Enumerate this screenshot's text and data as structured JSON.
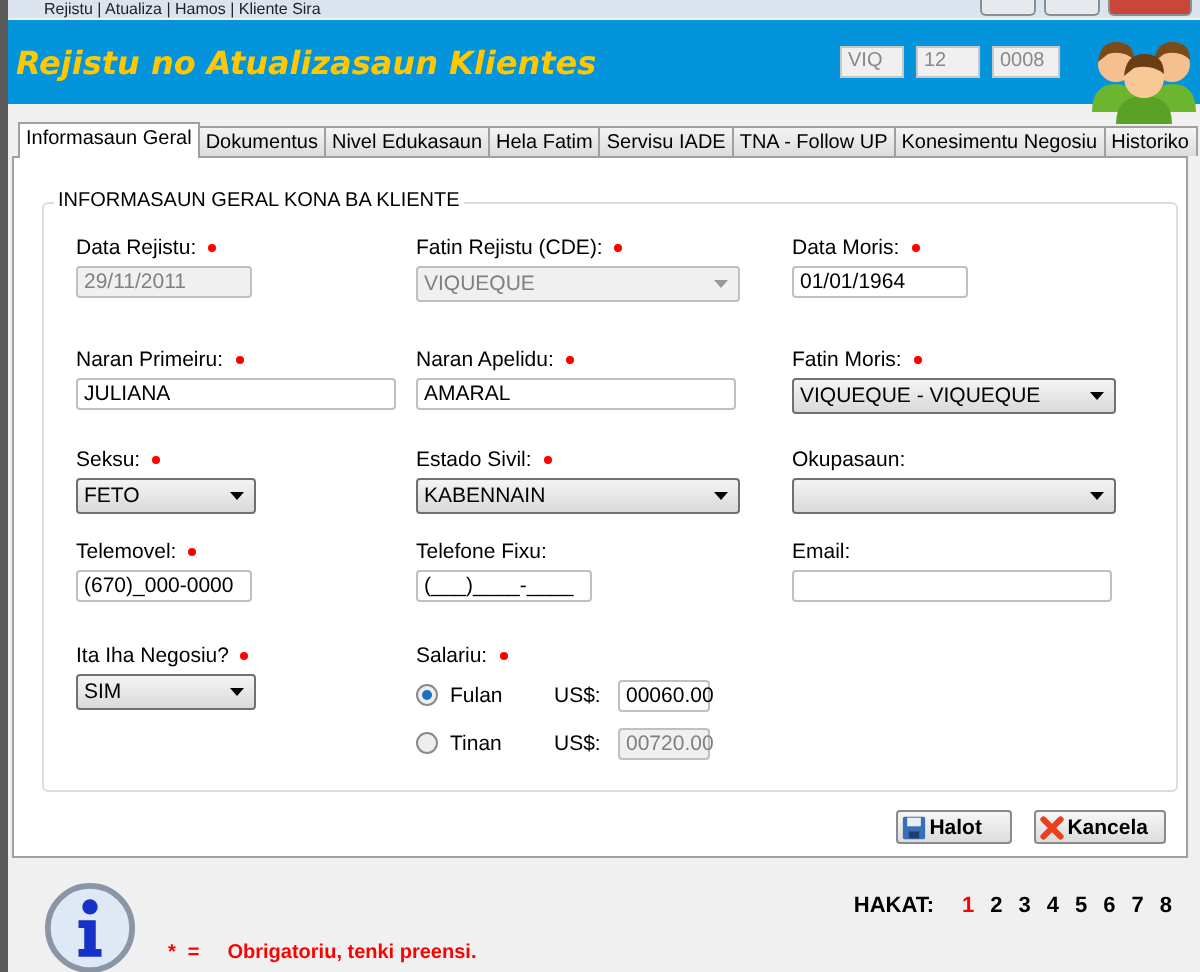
{
  "window": {
    "title": "Rejistu | Atualiza | Hamos | Kliente Sira"
  },
  "header": {
    "title": "Rejistu no Atualizasaun Klientes",
    "codes": [
      "VIQ",
      "12",
      "0008"
    ]
  },
  "tabs": [
    {
      "label": "Informasaun Geral",
      "selected": true
    },
    {
      "label": "Dokumentus",
      "selected": false
    },
    {
      "label": "Nivel Edukasaun",
      "selected": false
    },
    {
      "label": "Hela Fatim",
      "selected": false
    },
    {
      "label": "Servisu IADE",
      "selected": false
    },
    {
      "label": "TNA - Follow UP",
      "selected": false
    },
    {
      "label": "Konesimentu Negosiu",
      "selected": false
    },
    {
      "label": "Historiko",
      "selected": false
    }
  ],
  "group": {
    "title": "INFORMASAUN GERAL KONA BA KLIENTE",
    "fields": [
      {
        "label": "Data Rejistu:",
        "required": true,
        "kind": "text",
        "value": "29/11/2011",
        "disabled": true
      },
      {
        "label": "Fatin Rejistu (CDE):",
        "required": true,
        "kind": "dropdown",
        "value": "VIQUEQUE",
        "disabled": true
      },
      {
        "label": "Data Moris:",
        "required": true,
        "kind": "text",
        "value": "01/01/1964",
        "disabled": false
      },
      {
        "label": "Naran Primeiru:",
        "required": true,
        "kind": "text",
        "value": "JULIANA",
        "disabled": false
      },
      {
        "label": "Naran Apelidu:",
        "required": true,
        "kind": "text",
        "value": "AMARAL",
        "disabled": false
      },
      {
        "label": "Fatin Moris:",
        "required": true,
        "kind": "dropdown",
        "value": "VIQUEQUE - VIQUEQUE",
        "disabled": false
      },
      {
        "label": "Seksu:",
        "required": true,
        "kind": "dropdown",
        "value": "FETO",
        "disabled": false
      },
      {
        "label": "Estado Sivil:",
        "required": true,
        "kind": "dropdown",
        "value": "KABENNAIN",
        "disabled": false
      },
      {
        "label": "Okupasaun:",
        "required": false,
        "kind": "dropdown",
        "disabled": false
      },
      {
        "label": "Telemovel:",
        "required": true,
        "kind": "text",
        "value": "(670)_000-0000",
        "disabled": false
      },
      {
        "label": "Telefone Fixu:",
        "required": false,
        "kind": "text",
        "value": "(___)____-____",
        "disabled": false
      },
      {
        "label": "Email:",
        "required": false,
        "kind": "text",
        "disabled": false
      },
      {
        "label": "Ita Iha Negosiu?",
        "required": true,
        "kind": "dropdown",
        "value": "SIM",
        "disabled": false
      }
    ],
    "salary": {
      "label": "Salariu:",
      "required": true,
      "options": [
        {
          "label": "Fulan",
          "selected": true,
          "currency": "US$:",
          "value": "00060.00",
          "disabled": false
        },
        {
          "label": "Tinan",
          "selected": false,
          "currency": "US$:",
          "value": "00720.00",
          "disabled": true
        }
      ]
    }
  },
  "buttons": [
    {
      "label": "Halot",
      "kind": "save"
    },
    {
      "label": "Kancela",
      "kind": "cancel"
    }
  ],
  "footer": {
    "legend_mark": "*",
    "legend_equals": "=",
    "legend": "Obrigatoriu, tenki preensi.",
    "steps_label": "HAKAT:",
    "steps": [
      {
        "label": "1",
        "selected": true
      },
      {
        "label": "2",
        "selected": false
      },
      {
        "label": "3",
        "selected": false
      },
      {
        "label": "4",
        "selected": false
      },
      {
        "label": "5",
        "selected": false
      },
      {
        "label": "6",
        "selected": false
      },
      {
        "label": "7",
        "selected": false
      },
      {
        "label": "8",
        "selected": false
      }
    ]
  }
}
